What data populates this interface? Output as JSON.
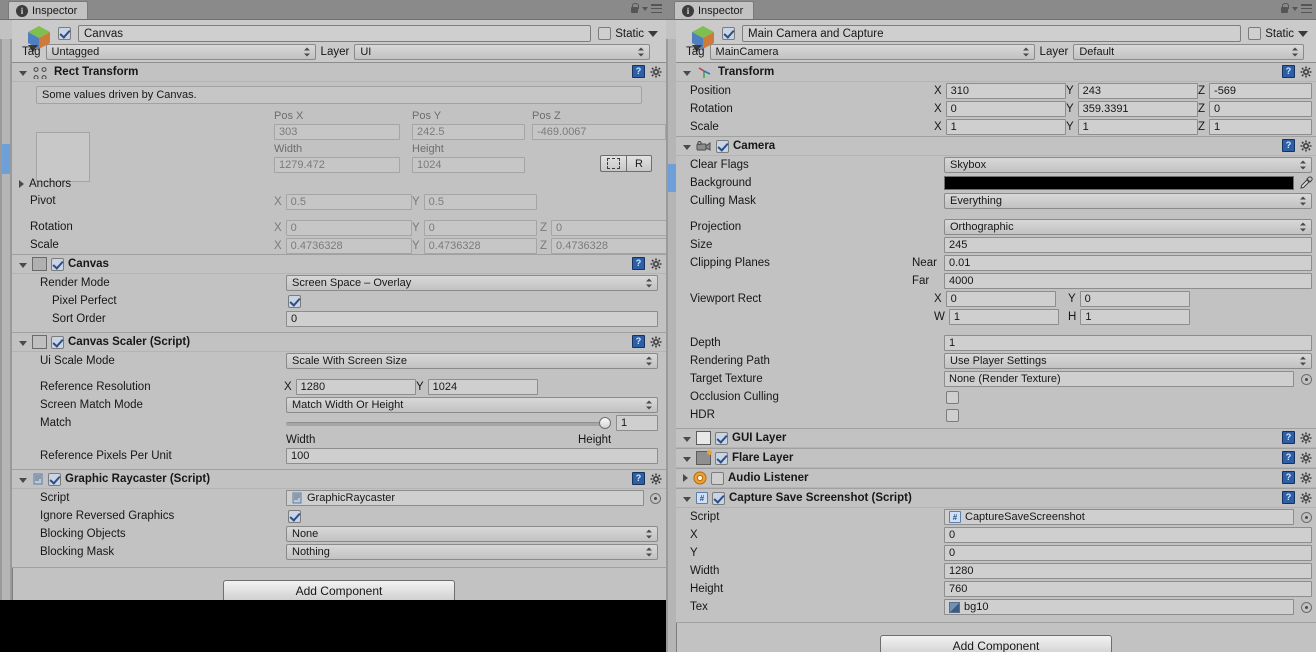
{
  "left_panel": {
    "tab": {
      "label": "Inspector",
      "icon": "info-icon"
    },
    "object": {
      "name": "Canvas",
      "enabled": true,
      "static_label": "Static",
      "tag_label": "Tag",
      "tag_value": "Untagged",
      "layer_label": "Layer",
      "layer_value": "UI"
    },
    "rect_transform": {
      "title": "Rect Transform",
      "info": "Some values driven by Canvas.",
      "headers": {
        "pos_x": "Pos X",
        "pos_y": "Pos Y",
        "pos_z": "Pos Z",
        "width": "Width",
        "height": "Height"
      },
      "pos_x": "303",
      "pos_y": "242.5",
      "pos_z": "-469.0067",
      "width": "1279.472",
      "height": "1024",
      "blueprint_button": "",
      "raw_button": "R",
      "anchors_label": "Anchors",
      "pivot_label": "Pivot",
      "pivot_x": "0.5",
      "pivot_y": "0.5",
      "rotation_label": "Rotation",
      "rot_x": "0",
      "rot_y": "0",
      "rot_z": "0",
      "scale_label": "Scale",
      "scale_x": "0.4736328",
      "scale_y": "0.4736328",
      "scale_z": "0.4736328"
    },
    "canvas": {
      "title": "Canvas",
      "enabled": true,
      "render_mode_label": "Render Mode",
      "render_mode_value": "Screen Space – Overlay",
      "pixel_perfect_label": "Pixel Perfect",
      "pixel_perfect": true,
      "sort_order_label": "Sort Order",
      "sort_order_value": "0"
    },
    "canvas_scaler": {
      "title": "Canvas Scaler (Script)",
      "enabled": true,
      "ui_scale_mode_label": "Ui Scale Mode",
      "ui_scale_mode_value": "Scale With Screen Size",
      "reference_resolution_label": "Reference Resolution",
      "ref_res_x": "1280",
      "ref_res_y": "1024",
      "screen_match_mode_label": "Screen Match Mode",
      "screen_match_mode_value": "Match Width Or Height",
      "match_label": "Match",
      "match_value": "1",
      "match_left": "Width",
      "match_right": "Height",
      "ref_px_label": "Reference Pixels Per Unit",
      "ref_px_value": "100"
    },
    "graphic_raycaster": {
      "title": "Graphic Raycaster (Script)",
      "enabled": true,
      "script_label": "Script",
      "script_value": "GraphicRaycaster",
      "ignore_reversed_label": "Ignore Reversed Graphics",
      "ignore_reversed": true,
      "blocking_objects_label": "Blocking Objects",
      "blocking_objects_value": "None",
      "blocking_mask_label": "Blocking Mask",
      "blocking_mask_value": "Nothing"
    },
    "add_component_label": "Add Component"
  },
  "right_panel": {
    "tab": {
      "label": "Inspector",
      "icon": "info-icon"
    },
    "object": {
      "name": "Main Camera and Capture",
      "enabled": true,
      "static_label": "Static",
      "tag_label": "Tag",
      "tag_value": "MainCamera",
      "layer_label": "Layer",
      "layer_value": "Default"
    },
    "transform": {
      "title": "Transform",
      "position_label": "Position",
      "pos_x": "310",
      "pos_y": "243",
      "pos_z": "-569",
      "rotation_label": "Rotation",
      "rot_x": "0",
      "rot_y": "359.3391",
      "rot_z": "0",
      "scale_label": "Scale",
      "scale_x": "1",
      "scale_y": "1",
      "scale_z": "1"
    },
    "camera": {
      "title": "Camera",
      "enabled": true,
      "clear_flags_label": "Clear Flags",
      "clear_flags_value": "Skybox",
      "background_label": "Background",
      "background_color": "#000000",
      "culling_mask_label": "Culling Mask",
      "culling_mask_value": "Everything",
      "projection_label": "Projection",
      "projection_value": "Orthographic",
      "size_label": "Size",
      "size_value": "245",
      "clipping_planes_label": "Clipping Planes",
      "near_label": "Near",
      "near_value": "0.01",
      "far_label": "Far",
      "far_value": "4000",
      "viewport_rect_label": "Viewport Rect",
      "vp_x": "0",
      "vp_y": "0",
      "vp_w": "1",
      "vp_h": "1",
      "depth_label": "Depth",
      "depth_value": "1",
      "rendering_path_label": "Rendering Path",
      "rendering_path_value": "Use Player Settings",
      "target_texture_label": "Target Texture",
      "target_texture_value": "None (Render Texture)",
      "occlusion_culling_label": "Occlusion Culling",
      "occlusion_culling": false,
      "hdr_label": "HDR",
      "hdr": false
    },
    "gui_layer": {
      "title": "GUI Layer",
      "enabled": true
    },
    "flare_layer": {
      "title": "Flare Layer",
      "enabled": true
    },
    "audio_listener": {
      "title": "Audio Listener",
      "enabled": false
    },
    "capture": {
      "title": "Capture Save Screenshot (Script)",
      "enabled": true,
      "script_label": "Script",
      "script_value": "CaptureSaveScreenshot",
      "x_label": "X",
      "x_value": "0",
      "y_label": "Y",
      "y_value": "0",
      "width_label": "Width",
      "width_value": "1280",
      "height_label": "Height",
      "height_value": "760",
      "tex_label": "Tex",
      "tex_value": "bg10"
    },
    "add_component_label": "Add Component"
  }
}
